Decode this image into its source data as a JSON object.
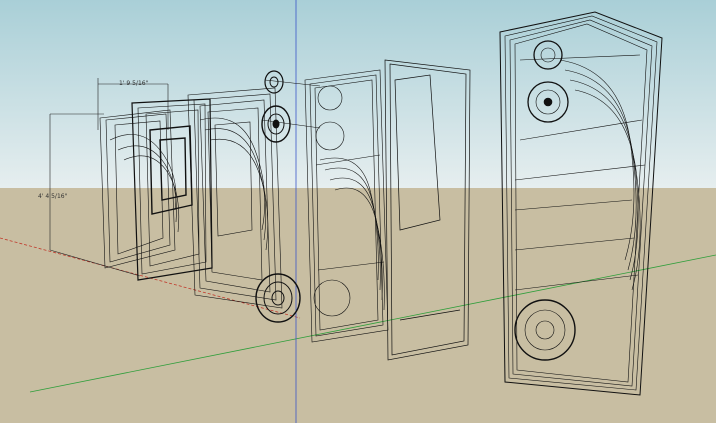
{
  "dimensions": {
    "width_label": "1' 9 5/16\"",
    "height_label": "4' 4 5/16\""
  },
  "colors": {
    "sky_top": "#a9cfd7",
    "sky_bottom": "#e6eeef",
    "ground": "#c8bea2",
    "wire": "#111111",
    "axis_red": "#c0392b",
    "axis_green": "#2e9e3a",
    "axis_blue": "#3a55c8"
  },
  "icons": {
    "dimension": "dimension-line-icon",
    "speaker": "speaker-driver-icon"
  }
}
